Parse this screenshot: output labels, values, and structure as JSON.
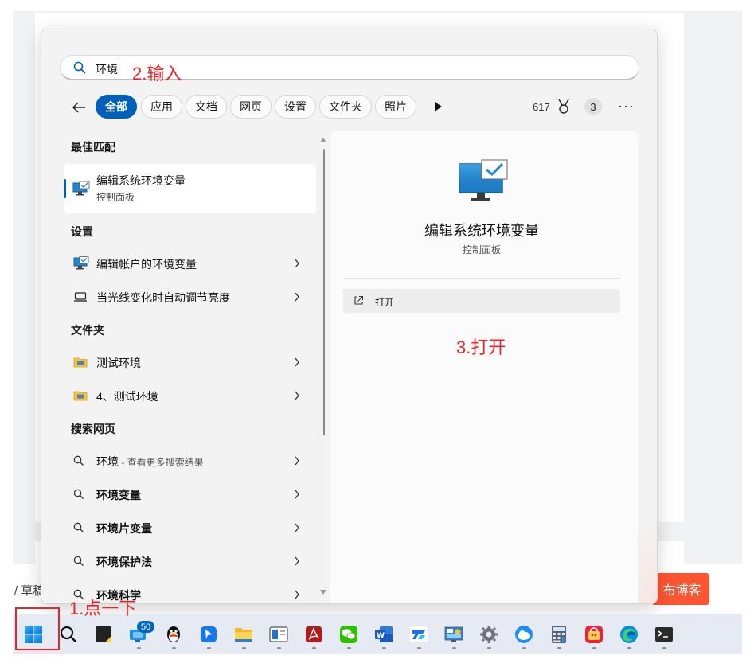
{
  "background": {
    "draft_label": "/ 草稿",
    "publish_label": "布博客"
  },
  "search": {
    "query": "环境",
    "annotation": "2.输入"
  },
  "filters": {
    "chips": [
      "全部",
      "应用",
      "文档",
      "网页",
      "设置",
      "文件夹",
      "照片"
    ],
    "active": "全部",
    "points": "617",
    "badge": "3",
    "more": "···"
  },
  "results": {
    "best_match_title": "最佳匹配",
    "best": {
      "title": "编辑系统环境变量",
      "subtitle": "控制面板"
    },
    "settings_title": "设置",
    "settings": [
      {
        "label": "编辑帐户的环境变量",
        "icon": "monitor-check-icon"
      },
      {
        "label": "当光线变化时自动调节亮度",
        "icon": "laptop-icon"
      }
    ],
    "folders_title": "文件夹",
    "folders": [
      {
        "label": "测试环境",
        "icon": "folder-icon"
      },
      {
        "label": "4、测试环境",
        "icon": "folder-icon"
      }
    ],
    "web_title": "搜索网页",
    "web": [
      {
        "label": "环境",
        "hint": " - 查看更多搜索结果"
      },
      {
        "label": "环境变量"
      },
      {
        "label": "环境片变量"
      },
      {
        "label": "环境保护法"
      },
      {
        "label": "环境科学"
      }
    ]
  },
  "detail": {
    "title": "编辑系统环境变量",
    "subtitle": "控制面板",
    "open_label": "打开",
    "annotation": "3.打开"
  },
  "taskbar": {
    "annotation": "1.点一下",
    "notification_count": "50",
    "items": [
      "windows-start-icon",
      "search-icon",
      "sticky-notes-icon",
      "remote-desktop-icon",
      "qq-icon",
      "feishu-icon",
      "file-explorer-icon",
      "app-window-icon",
      "pdf-reader-icon",
      "wechat-icon",
      "word-icon",
      "todesk-icon",
      "control-panel-icon",
      "settings-gear-icon",
      "cloud-drive-icon",
      "calculator-icon",
      "shopping-app-icon",
      "edge-icon",
      "terminal-icon"
    ]
  },
  "colors": {
    "accent": "#005fb8",
    "annotation_red": "#e8262a",
    "publish_orange": "#fc5531"
  }
}
